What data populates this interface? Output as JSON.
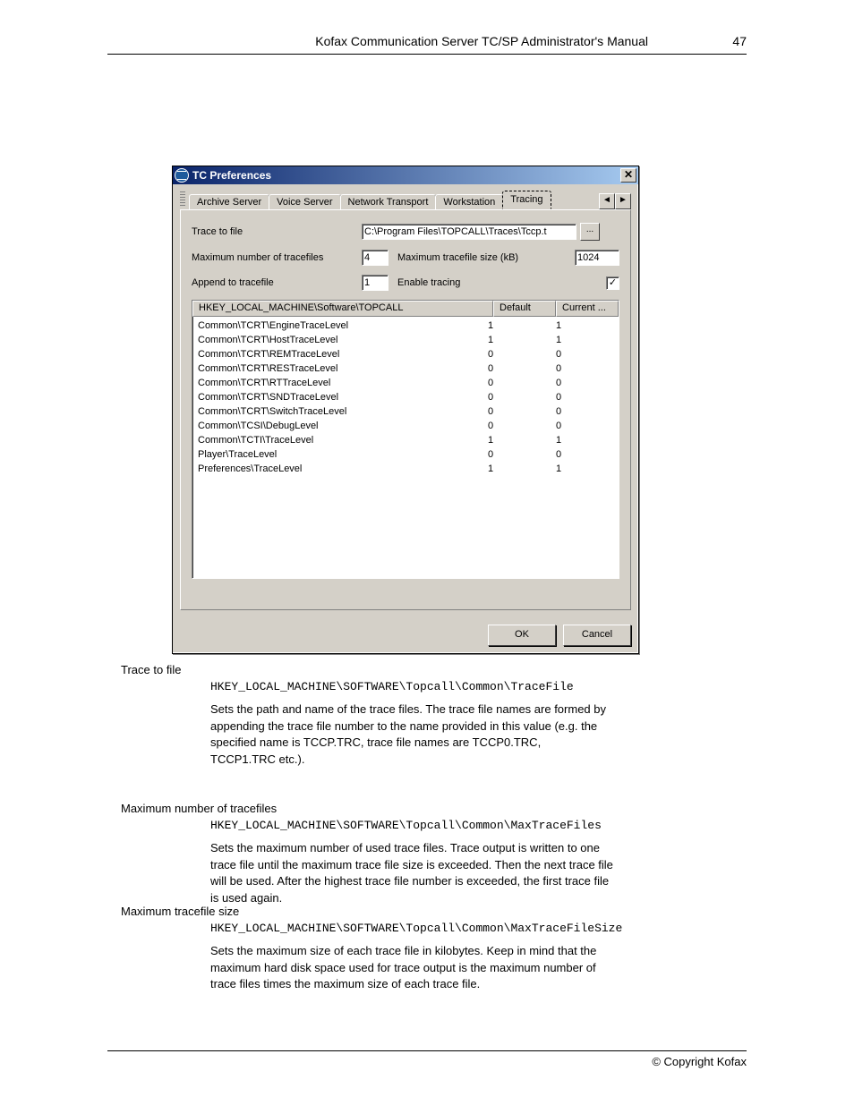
{
  "header": {
    "title": "Kofax Communication Server TC/SP Administrator's Manual",
    "page": "47"
  },
  "dialog": {
    "title": "TC Preferences",
    "close": "✕",
    "tabs": {
      "items": [
        "Archive Server",
        "Voice Server",
        "Network Transport",
        "Workstation",
        "Tracing"
      ],
      "active": 4,
      "scroll_left": "◄",
      "scroll_right": "►"
    },
    "form": {
      "trace_to_file_label": "Trace to file",
      "trace_to_file_value": "C:\\Program Files\\TOPCALL\\Traces\\Tccp.t",
      "browse": "...",
      "max_files_label": "Maximum number of tracefiles",
      "max_files_value": "4",
      "max_size_label": "Maximum tracefile size (kB)",
      "max_size_value": "1024",
      "append_label": "Append to tracefile",
      "append_value": "1",
      "enable_label": "Enable tracing",
      "enable_checked": "✓"
    },
    "list": {
      "header_path": "HKEY_LOCAL_MACHINE\\Software\\TOPCALL",
      "header_default": "Default",
      "header_current": "Current ...",
      "rows": [
        {
          "path": "Common\\TCRT\\EngineTraceLevel",
          "def": "1",
          "cur": "1"
        },
        {
          "path": "Common\\TCRT\\HostTraceLevel",
          "def": "1",
          "cur": "1"
        },
        {
          "path": "Common\\TCRT\\REMTraceLevel",
          "def": "0",
          "cur": "0"
        },
        {
          "path": "Common\\TCRT\\RESTraceLevel",
          "def": "0",
          "cur": "0"
        },
        {
          "path": "Common\\TCRT\\RTTraceLevel",
          "def": "0",
          "cur": "0"
        },
        {
          "path": "Common\\TCRT\\SNDTraceLevel",
          "def": "0",
          "cur": "0"
        },
        {
          "path": "Common\\TCRT\\SwitchTraceLevel",
          "def": "0",
          "cur": "0"
        },
        {
          "path": "Common\\TCSI\\DebugLevel",
          "def": "0",
          "cur": "0"
        },
        {
          "path": "Common\\TCTI\\TraceLevel",
          "def": "1",
          "cur": "1"
        },
        {
          "path": "Player\\TraceLevel",
          "def": "0",
          "cur": "0"
        },
        {
          "path": "Preferences\\TraceLevel",
          "def": "1",
          "cur": "1"
        }
      ]
    },
    "buttons": {
      "ok": "OK",
      "cancel": "Cancel"
    }
  },
  "sections": [
    {
      "label": "Trace to file",
      "reg": "HKEY_LOCAL_MACHINE\\SOFTWARE\\Topcall\\Common\\TraceFile",
      "desc_lines": [
        "Sets the path and name of the trace files. The trace file names are formed by",
        "appending the trace file number to the name provided in this value (e.g. the",
        "specified name is TCCP.TRC, trace file names are TCCP0.TRC,",
        "TCCP1.TRC etc.)."
      ]
    },
    {
      "label": "Maximum number of tracefiles",
      "reg": "HKEY_LOCAL_MACHINE\\SOFTWARE\\Topcall\\Common\\MaxTraceFiles",
      "desc_lines": [
        "Sets the maximum number of used trace files. Trace output is written to one",
        "trace file until the maximum trace file size is exceeded. Then the next trace file",
        "will be used. After the highest trace file number is exceeded, the first trace file",
        "is used again."
      ]
    },
    {
      "label": "Maximum tracefile size",
      "reg": "HKEY_LOCAL_MACHINE\\SOFTWARE\\Topcall\\Common\\MaxTraceFileSize",
      "desc_lines": [
        "Sets the maximum size of each trace file in kilobytes. Keep in mind that the",
        "maximum hard disk space used for trace output is the maximum number of",
        "trace files times the maximum size of each trace file."
      ]
    }
  ],
  "footer": {
    "copyright": "© Copyright Kofax"
  }
}
